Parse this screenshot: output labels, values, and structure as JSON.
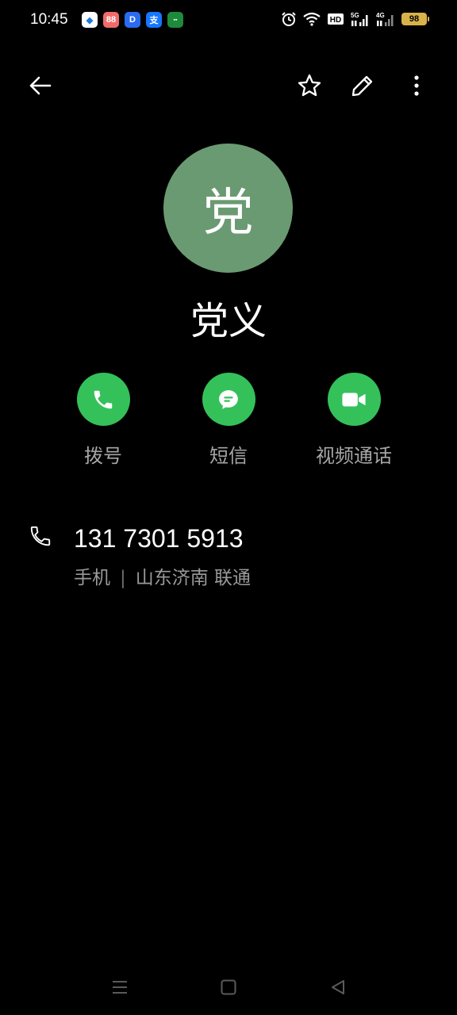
{
  "status_bar": {
    "time": "10:45",
    "notifications": [
      {
        "name": "app-icon-1",
        "glyph": "◆",
        "color": "#ffffff",
        "fg": "#1f7ae0"
      },
      {
        "name": "app-icon-2",
        "glyph": "88",
        "color": "#f26b6b",
        "fg": "#ffffff"
      },
      {
        "name": "app-icon-3",
        "glyph": "D",
        "color": "#2a6cf0",
        "fg": "#ffffff"
      },
      {
        "name": "alipay-icon",
        "glyph": "支",
        "color": "#1677ff",
        "fg": "#ffffff"
      },
      {
        "name": "app-icon-5",
        "glyph": "▪▪",
        "color": "#1e8a3c",
        "fg": "#ffffff"
      }
    ],
    "signal_5g_label": "5G",
    "signal_4g_label": "4G",
    "hd_label": "HD",
    "battery_level": "98"
  },
  "colors": {
    "background": "#000000",
    "avatar": "#6a9a72",
    "action_green": "#34c15a"
  },
  "contact": {
    "avatar_initial": "党",
    "name": "党义"
  },
  "actions": {
    "dial_label": "拨号",
    "sms_label": "短信",
    "video_label": "视频通话"
  },
  "phone": {
    "number": "131 7301 5913",
    "type": "手机",
    "separator": "|",
    "location": "山东济南 联通"
  }
}
